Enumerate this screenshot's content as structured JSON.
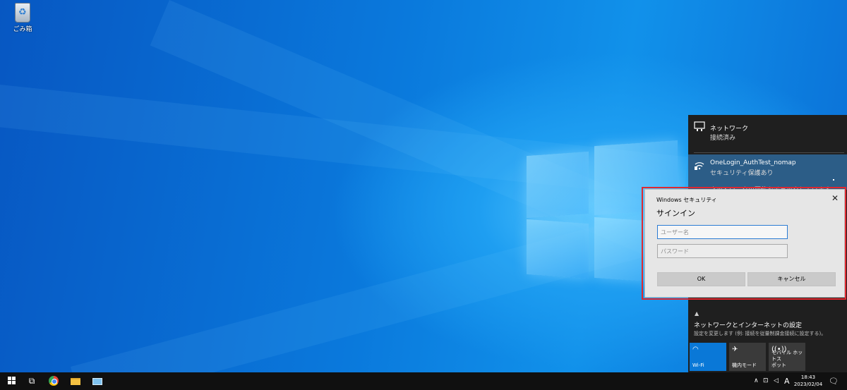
{
  "desktop": {
    "recycle_bin_label": "ごみ箱"
  },
  "network_flyout": {
    "ethernet": {
      "name": "ネットワーク",
      "status": "接続済み",
      "icon": "ethernet-icon"
    },
    "wifi": {
      "ssid": "OneLogin_AuthTest_nomap",
      "security": "セキュリティ保護あり",
      "status": "ネットワークの要件をチェックしています",
      "icon": "wifi-secured-icon"
    },
    "settings_link": "ネットワークとインターネットの設定",
    "settings_description": "設定を変更します (例: 接続を従量制課金接続に設定する)。",
    "quick_actions": [
      {
        "label": "Wi-Fi",
        "icon": "wifi-icon",
        "active": true
      },
      {
        "label": "機内モード",
        "icon": "airplane-icon",
        "active": false
      },
      {
        "label": "モバイル ホットス\nポット",
        "icon": "hotspot-icon",
        "active": false
      }
    ]
  },
  "dialog": {
    "title": "Windows セキュリティ",
    "heading": "サインイン",
    "username_placeholder": "ユーザー名",
    "password_placeholder": "パスワード",
    "ok_label": "OK",
    "cancel_label": "キャンセル",
    "highlight_color": "#e0282f"
  },
  "taskbar": {
    "time": "18:43",
    "date": "2023/02/04",
    "ime_indicator": "A",
    "apps": [
      "start",
      "task-view",
      "chrome",
      "file-explorer",
      "remote-desktop"
    ]
  },
  "colors": {
    "accent": "#0a78d7",
    "selected_network": "#2c5d87",
    "flyout_bg": "#1f1f1f",
    "taskbar_bg": "#101010"
  }
}
